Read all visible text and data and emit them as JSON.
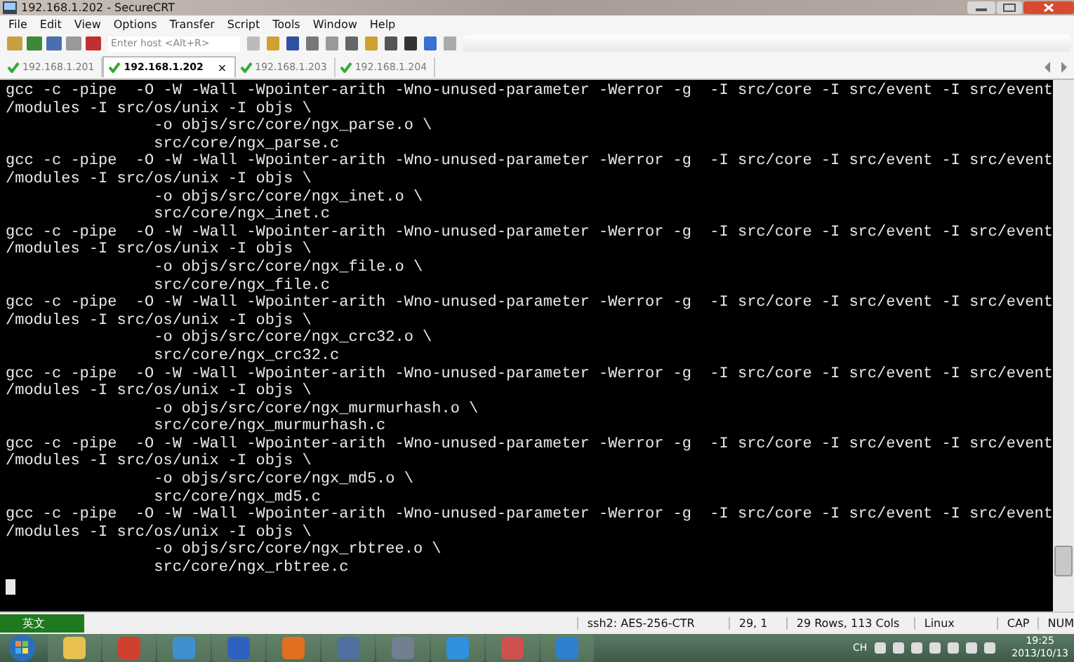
{
  "window": {
    "title": "192.168.1.202 - SecureCRT"
  },
  "menu": [
    "File",
    "Edit",
    "View",
    "Options",
    "Transfer",
    "Script",
    "Tools",
    "Window",
    "Help"
  ],
  "toolbar": {
    "host_placeholder": "Enter host <Alt+R>"
  },
  "tabs": [
    {
      "label": "192.168.1.201",
      "selected": false
    },
    {
      "label": "192.168.1.202",
      "selected": true,
      "close": "×"
    },
    {
      "label": "192.168.1.203",
      "selected": false
    },
    {
      "label": "192.168.1.204",
      "selected": false
    }
  ],
  "terminal": {
    "lines": [
      "gcc -c -pipe  -O -W -Wall -Wpointer-arith -Wno-unused-parameter -Werror -g  -I src/core -I src/event -I src/event",
      "/modules -I src/os/unix -I objs \\",
      "                -o objs/src/core/ngx_parse.o \\",
      "                src/core/ngx_parse.c",
      "gcc -c -pipe  -O -W -Wall -Wpointer-arith -Wno-unused-parameter -Werror -g  -I src/core -I src/event -I src/event",
      "/modules -I src/os/unix -I objs \\",
      "                -o objs/src/core/ngx_inet.o \\",
      "                src/core/ngx_inet.c",
      "gcc -c -pipe  -O -W -Wall -Wpointer-arith -Wno-unused-parameter -Werror -g  -I src/core -I src/event -I src/event",
      "/modules -I src/os/unix -I objs \\",
      "                -o objs/src/core/ngx_file.o \\",
      "                src/core/ngx_file.c",
      "gcc -c -pipe  -O -W -Wall -Wpointer-arith -Wno-unused-parameter -Werror -g  -I src/core -I src/event -I src/event",
      "/modules -I src/os/unix -I objs \\",
      "                -o objs/src/core/ngx_crc32.o \\",
      "                src/core/ngx_crc32.c",
      "gcc -c -pipe  -O -W -Wall -Wpointer-arith -Wno-unused-parameter -Werror -g  -I src/core -I src/event -I src/event",
      "/modules -I src/os/unix -I objs \\",
      "                -o objs/src/core/ngx_murmurhash.o \\",
      "                src/core/ngx_murmurhash.c",
      "gcc -c -pipe  -O -W -Wall -Wpointer-arith -Wno-unused-parameter -Werror -g  -I src/core -I src/event -I src/event",
      "/modules -I src/os/unix -I objs \\",
      "                -o objs/src/core/ngx_md5.o \\",
      "                src/core/ngx_md5.c",
      "gcc -c -pipe  -O -W -Wall -Wpointer-arith -Wno-unused-parameter -Werror -g  -I src/core -I src/event -I src/event",
      "/modules -I src/os/unix -I objs \\",
      "                -o objs/src/core/ngx_rbtree.o \\",
      "                src/core/ngx_rbtree.c"
    ]
  },
  "status_bar": {
    "ime": "英文",
    "cipher": "ssh2: AES-256-CTR",
    "position": "29,  1",
    "size": "29 Rows, 113 Cols",
    "os": "Linux",
    "caps": "CAP",
    "num": "NUM"
  },
  "taskbar": {
    "language": "CH",
    "time": "19:25",
    "date": "2013/10/13"
  }
}
